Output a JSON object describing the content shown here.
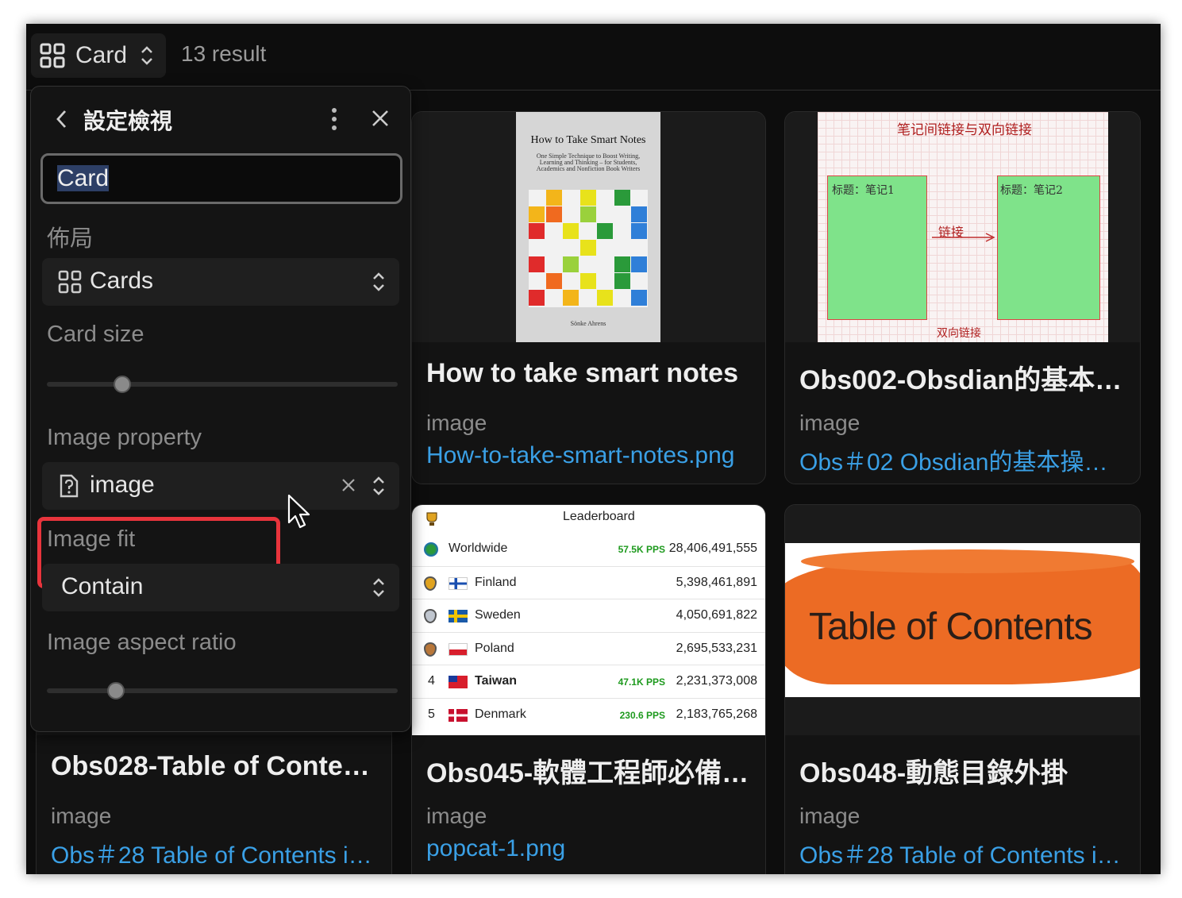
{
  "toolbar": {
    "view_label": "Card",
    "result_count": "13 result"
  },
  "panel": {
    "title": "設定檢視",
    "view_name": "Card",
    "layout_label": "佈局",
    "layout_value": "Cards",
    "card_size_label": "Card size",
    "card_size_fraction": 0.2,
    "image_property_label": "Image property",
    "image_property_value": "image",
    "image_fit_label": "Image fit",
    "image_fit_value": "Contain",
    "aspect_ratio_label": "Image aspect ratio",
    "aspect_ratio_fraction": 0.18
  },
  "cards": [
    {
      "title": "How to take smart notes",
      "prop_label": "image",
      "prop_value": "How-to-take-smart-notes.png"
    },
    {
      "title": "Obs002-Obsdian的基本…",
      "prop_label": "image",
      "prop_value": "Obs＃02 Obsdian的基本操作…"
    },
    {
      "title": "Obs028-Table of Conte…",
      "prop_label": "image",
      "prop_value": "Obs＃28 Table of Contents i…"
    },
    {
      "title": "Obs045-軟體工程師必備…",
      "prop_label": "image",
      "prop_value": "popcat-1.png"
    },
    {
      "title": "Obs048-動態目錄外掛",
      "prop_label": "image",
      "prop_value": "Obs＃28 Table of Contents i…"
    }
  ],
  "book": {
    "title": "How to Take Smart Notes",
    "subtitle": "One Simple Technique to Boost Writing, Learning and Thinking – for Students, Academics and Nonfiction Book Writers",
    "author": "Sönke Ahrens"
  },
  "notes_image": {
    "header": "笔记间链接与双向链接",
    "left_title": "标题：笔记1",
    "right_title": "标题：笔记2",
    "arrow_label": "链接",
    "bottom_label": "双向链接"
  },
  "leaderboard": {
    "title": "Leaderboard",
    "rows": [
      {
        "rank": "",
        "name": "Worldwide",
        "pps": "57.5K PPS",
        "score": "28,406,491,555"
      },
      {
        "rank": "",
        "name": "Finland",
        "pps": "",
        "score": "5,398,461,891"
      },
      {
        "rank": "",
        "name": "Sweden",
        "pps": "",
        "score": "4,050,691,822"
      },
      {
        "rank": "",
        "name": "Poland",
        "pps": "",
        "score": "2,695,533,231"
      },
      {
        "rank": "4",
        "name": "Taiwan",
        "pps": "47.1K PPS",
        "score": "2,231,373,008"
      },
      {
        "rank": "5",
        "name": "Denmark",
        "pps": "230.6 PPS",
        "score": "2,183,765,268"
      }
    ]
  },
  "toc_image": {
    "text": "Table of Contents"
  },
  "colors": {
    "link": "#3aa0e6",
    "highlight": "#e8343c",
    "toc_orange": "#ec6b24"
  }
}
